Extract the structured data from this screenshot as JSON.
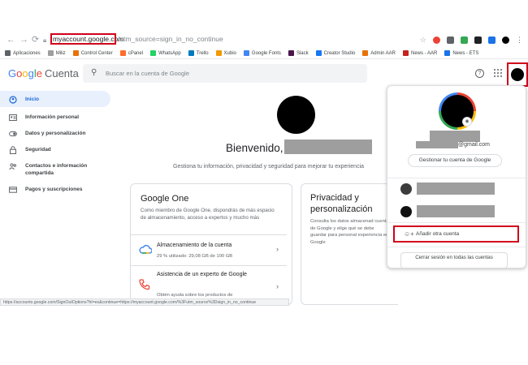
{
  "browser": {
    "url_host": "myaccount.google.com",
    "url_rest": "/utm_source=sign_in_no_continue",
    "bookmarks": [
      {
        "label": "Aplicaciones",
        "color": "#5f6368"
      },
      {
        "label": "Miliz",
        "color": "#9e9e9e"
      },
      {
        "label": "Control Center",
        "color": "#e8710a"
      },
      {
        "label": "cPanel",
        "color": "#ff6c2c"
      },
      {
        "label": "WhatsApp",
        "color": "#25d366"
      },
      {
        "label": "Trello",
        "color": "#0079bf"
      },
      {
        "label": "Xubio",
        "color": "#f29900"
      },
      {
        "label": "Google Fonts",
        "color": "#4285f4"
      },
      {
        "label": "Slack",
        "color": "#4a154b"
      },
      {
        "label": "Creator Studio",
        "color": "#1877f2"
      },
      {
        "label": "Admin AAR",
        "color": "#e8710a"
      },
      {
        "label": "News - AAR",
        "color": "#c5221f"
      },
      {
        "label": "News - ETS",
        "color": "#1a73e8"
      }
    ],
    "status_text": "https://accounts.google.com/SignOutOptions?hl=es&continue=https://myaccount.google.com/%3Futm_source%3Dsign_in_no_continue"
  },
  "header": {
    "logo_letters": [
      "G",
      "o",
      "o",
      "g",
      "l",
      "e"
    ],
    "product": "Cuenta",
    "search_placeholder": "Buscar en la cuenta de Google"
  },
  "sidebar": {
    "items": [
      {
        "label": "Inicio",
        "icon": "home-icon"
      },
      {
        "label": "Información personal",
        "icon": "id-card-icon"
      },
      {
        "label": "Datos y personalización",
        "icon": "toggle-icon"
      },
      {
        "label": "Seguridad",
        "icon": "lock-icon"
      },
      {
        "label": "Contactos e información compartida",
        "icon": "people-icon"
      },
      {
        "label": "Pagos y suscripciones",
        "icon": "card-icon"
      }
    ]
  },
  "main": {
    "welcome": "Bienvenido,",
    "subtitle": "Gestiona tu información, privacidad y seguridad para mejorar tu experiencia",
    "google_one": {
      "title": "Google One",
      "description": "Como miembro de Google One, dispondrás de más espacio de almacenamiento, acceso a expertos y mucho más",
      "rows": [
        {
          "title": "Almacenamiento de la cuenta",
          "sub": "29 % utilizado: 29,08 GB de 100 GB"
        },
        {
          "title": "Asistencia de un experto de Google",
          "sub": "Obtén ayuda sobre los productos de"
        }
      ]
    },
    "privacy": {
      "title": "Privacidad y personalización",
      "description": "Consulta los datos almacenad cuenta de Google y elige qué se debe guardar para personal experiencia en Google"
    }
  },
  "panel": {
    "email_suffix": "@gmail.com",
    "manage_label": "Gestionar tu cuenta de Google",
    "add_account_label": "Añadir otra cuenta",
    "signout_label": "Cerrar sesión en todas las cuentas"
  }
}
